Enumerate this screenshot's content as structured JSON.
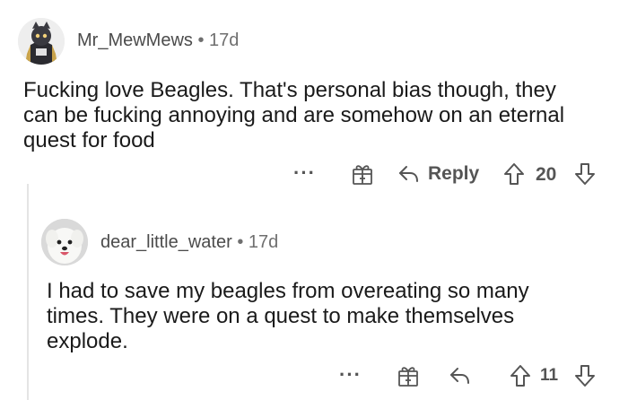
{
  "comments": [
    {
      "username": "Mr_MewMews",
      "separator": "•",
      "age": "17d",
      "lines": [
        "Fucking love Beagles. That's personal bias though, they",
        "can be fucking annoying and are somehow on an eternal",
        "quest for food"
      ],
      "actions": {
        "more": "···",
        "reply_label": "Reply",
        "upvotes": "20"
      }
    },
    {
      "username": "dear_little_water",
      "separator": "•",
      "age": "17d",
      "lines": [
        "I had to save my beagles from overeating so many",
        "times.  They were on a quest to make themselves",
        "explode."
      ],
      "actions": {
        "more": "···",
        "upvotes": "11"
      }
    }
  ],
  "icons": {
    "award": "gift-icon",
    "reply": "reply-arrow-icon",
    "upvote": "upvote-arrow-icon",
    "downvote": "downvote-arrow-icon"
  },
  "colors": {
    "text": "#1a1a1a",
    "meta": "#6f6f6f",
    "icon": "#555555",
    "thread_line": "#e4e4e4"
  }
}
